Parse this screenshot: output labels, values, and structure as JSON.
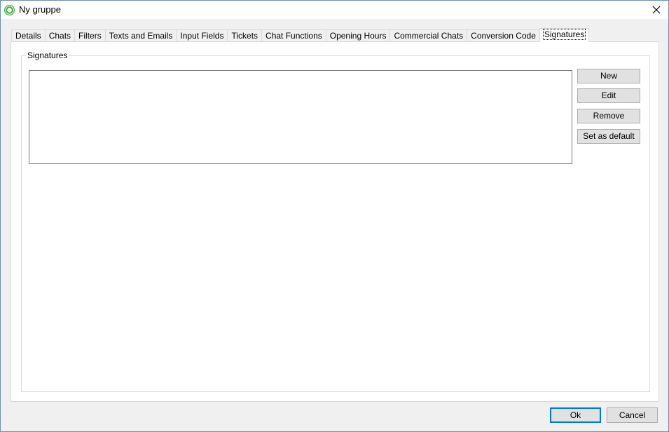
{
  "window": {
    "title": "Ny gruppe"
  },
  "tabs": [
    {
      "label": "Details"
    },
    {
      "label": "Chats"
    },
    {
      "label": "Filters"
    },
    {
      "label": "Texts and Emails"
    },
    {
      "label": "Input Fields"
    },
    {
      "label": "Tickets"
    },
    {
      "label": "Chat Functions"
    },
    {
      "label": "Opening Hours"
    },
    {
      "label": "Commercial Chats"
    },
    {
      "label": "Conversion Code"
    },
    {
      "label": "Signatures"
    }
  ],
  "active_tab": "Signatures",
  "signatures": {
    "group_label": "Signatures",
    "items": [],
    "buttons": {
      "new": "New",
      "edit": "Edit",
      "remove": "Remove",
      "set_default": "Set as default"
    }
  },
  "dialog": {
    "ok": "Ok",
    "cancel": "Cancel"
  },
  "colors": {
    "accent": "#0078d7",
    "app_icon": "#3fae3a"
  }
}
